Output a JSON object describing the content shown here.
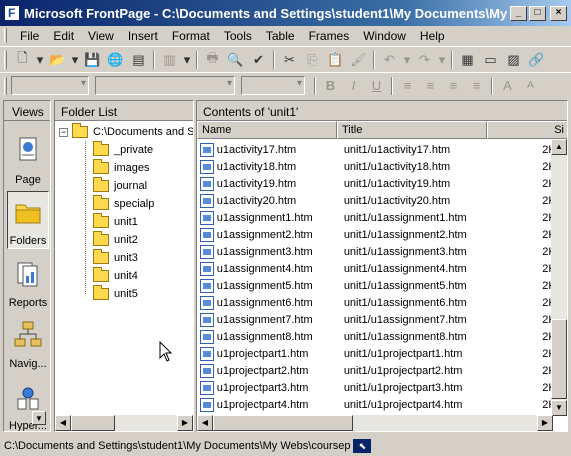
{
  "window": {
    "title": "Microsoft FrontPage - C:\\Documents and Settings\\student1\\My Documents\\My Webs..."
  },
  "menu": [
    "File",
    "Edit",
    "View",
    "Insert",
    "Format",
    "Tools",
    "Table",
    "Frames",
    "Window",
    "Help"
  ],
  "views": {
    "header": "Views",
    "items": [
      {
        "label": "Page",
        "icon": "page-view-icon"
      },
      {
        "label": "Folders",
        "icon": "folders-view-icon"
      },
      {
        "label": "Reports",
        "icon": "reports-view-icon"
      },
      {
        "label": "Navig...",
        "icon": "navigation-view-icon"
      },
      {
        "label": "Hyper...",
        "icon": "hyperlinks-view-icon"
      }
    ]
  },
  "folder_list": {
    "header": "Folder List",
    "root": "C:\\Documents and S",
    "folders": [
      "_private",
      "images",
      "journal",
      "specialp",
      "unit1",
      "unit2",
      "unit3",
      "unit4",
      "unit5"
    ]
  },
  "contents": {
    "header": "Contents of 'unit1'",
    "columns": [
      "Name",
      "Title",
      "Si"
    ],
    "files": [
      {
        "name": "u1activity17.htm",
        "title": "unit1/u1activity17.htm",
        "size": "2K"
      },
      {
        "name": "u1activity18.htm",
        "title": "unit1/u1activity18.htm",
        "size": "2K"
      },
      {
        "name": "u1activity19.htm",
        "title": "unit1/u1activity19.htm",
        "size": "2K"
      },
      {
        "name": "u1activity20.htm",
        "title": "unit1/u1activity20.htm",
        "size": "2K"
      },
      {
        "name": "u1assignment1.htm",
        "title": "unit1/u1assignment1.htm",
        "size": "2K"
      },
      {
        "name": "u1assignment2.htm",
        "title": "unit1/u1assignment2.htm",
        "size": "2K"
      },
      {
        "name": "u1assignment3.htm",
        "title": "unit1/u1assignment3.htm",
        "size": "2K"
      },
      {
        "name": "u1assignment4.htm",
        "title": "unit1/u1assignment4.htm",
        "size": "2K"
      },
      {
        "name": "u1assignment5.htm",
        "title": "unit1/u1assignment5.htm",
        "size": "2K"
      },
      {
        "name": "u1assignment6.htm",
        "title": "unit1/u1assignment6.htm",
        "size": "2K"
      },
      {
        "name": "u1assignment7.htm",
        "title": "unit1/u1assignment7.htm",
        "size": "2K"
      },
      {
        "name": "u1assignment8.htm",
        "title": "unit1/u1assignment8.htm",
        "size": "2K"
      },
      {
        "name": "u1projectpart1.htm",
        "title": "unit1/u1projectpart1.htm",
        "size": "2K"
      },
      {
        "name": "u1projectpart2.htm",
        "title": "unit1/u1projectpart2.htm",
        "size": "2K"
      },
      {
        "name": "u1projectpart3.htm",
        "title": "unit1/u1projectpart3.htm",
        "size": "2K"
      },
      {
        "name": "u1projectpart4.htm",
        "title": "unit1/u1projectpart4.htm",
        "size": "2K"
      }
    ]
  },
  "status": {
    "path": "C:\\Documents and Settings\\student1\\My Documents\\My Webs\\coursep"
  }
}
